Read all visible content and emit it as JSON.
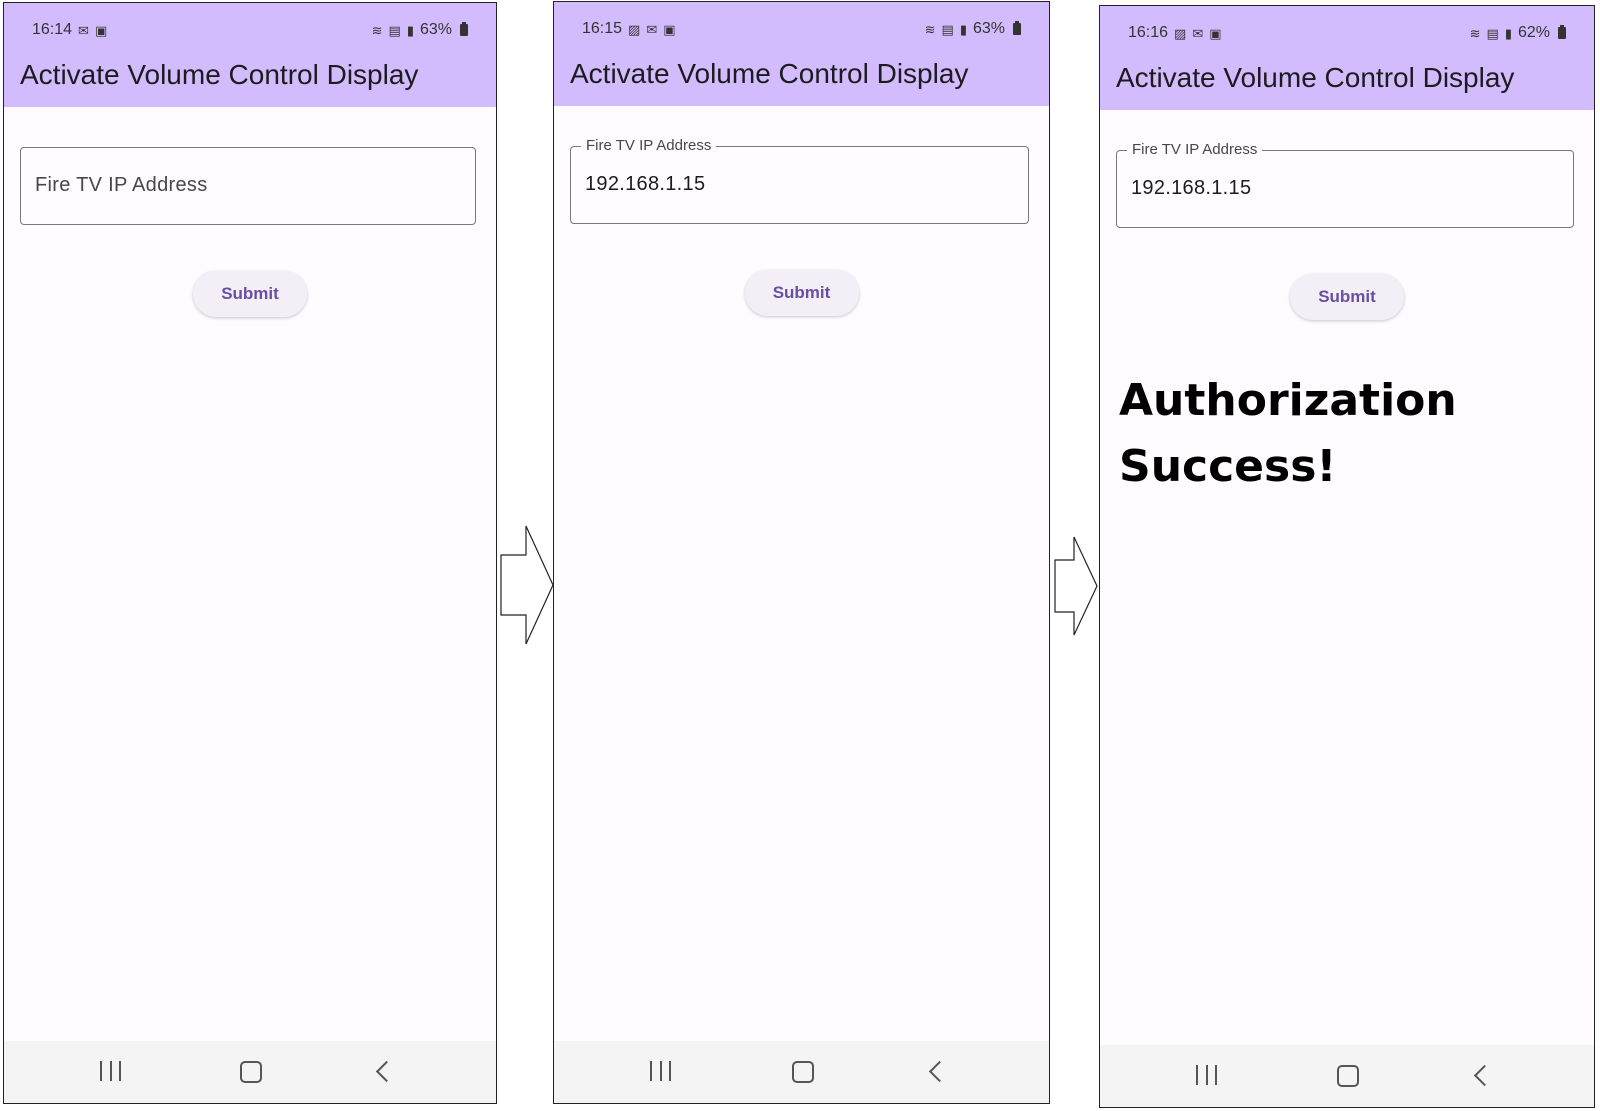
{
  "screens": [
    {
      "status": {
        "time": "16:14",
        "battery": "63%"
      },
      "app_title": "Activate Volume Control Display",
      "ip_field": {
        "label": "",
        "value": "",
        "placeholder": "Fire TV IP Address"
      },
      "submit_label": "Submit",
      "result_lines": []
    },
    {
      "status": {
        "time": "16:15",
        "battery": "63%"
      },
      "app_title": "Activate Volume Control Display",
      "ip_field": {
        "label": "Fire TV IP Address",
        "value": "192.168.1.15",
        "placeholder": ""
      },
      "submit_label": "Submit",
      "result_lines": []
    },
    {
      "status": {
        "time": "16:16",
        "battery": "62%"
      },
      "app_title": "Activate Volume Control Display",
      "ip_field": {
        "label": "Fire TV IP Address",
        "value": "192.168.1.15",
        "placeholder": ""
      },
      "submit_label": "Submit",
      "result_lines": [
        "Authorization",
        "Success!"
      ]
    }
  ],
  "status_icons": [
    "gmail-icon",
    "calendar-icon",
    "image-icon",
    "wifi-icon",
    "volte-icon",
    "signal-icon",
    "battery-icon"
  ],
  "nav_icons": [
    "recents-icon",
    "home-icon",
    "back-icon"
  ],
  "colors": {
    "app_bar": "#d3bcfd",
    "background": "#fffbff",
    "accent": "#6750a4",
    "nav_bar": "#f4f4f4"
  }
}
